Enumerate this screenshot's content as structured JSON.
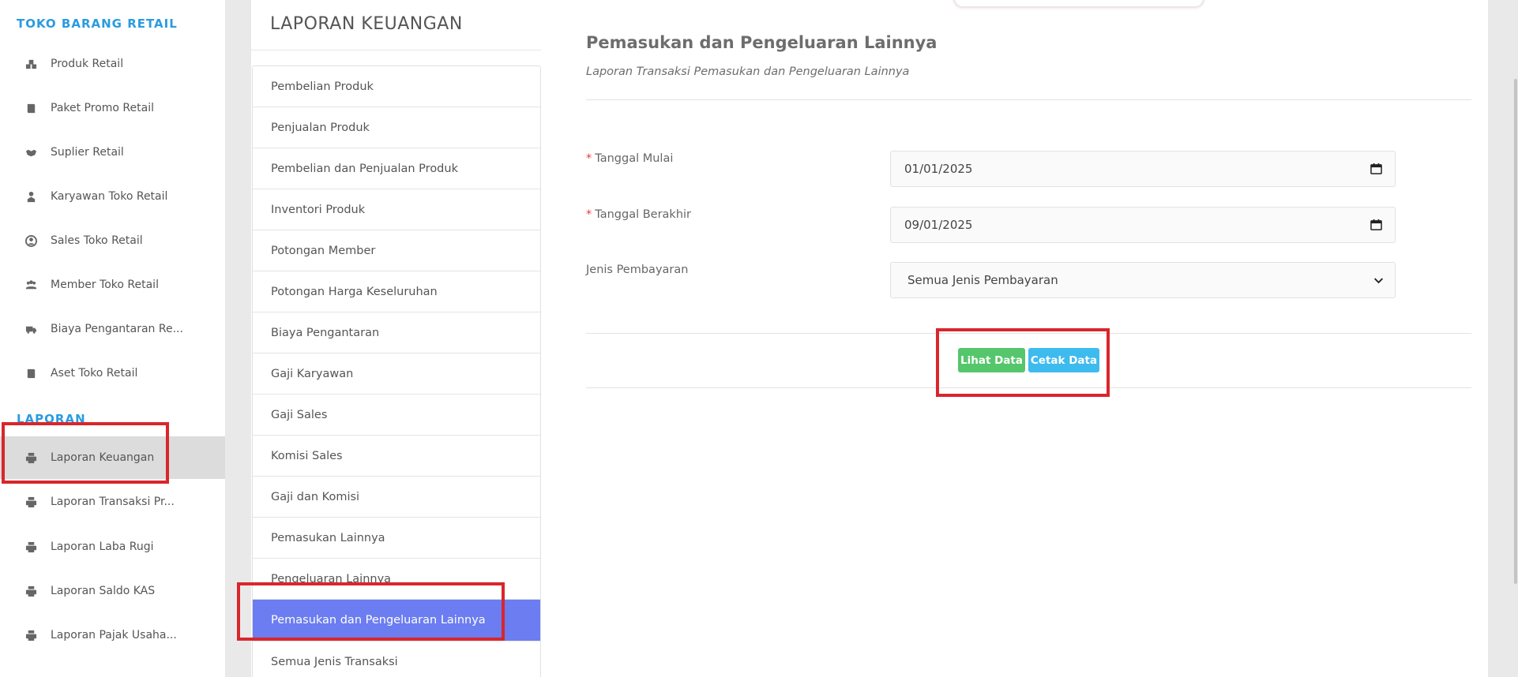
{
  "sidebar": {
    "section_retail": "TOKO BARANG RETAIL",
    "retail_items": [
      {
        "label": "Produk Retail",
        "icon": "cubes-icon"
      },
      {
        "label": "Paket Promo Retail",
        "icon": "book-icon"
      },
      {
        "label": "Suplier Retail",
        "icon": "handshake-icon"
      },
      {
        "label": "Karyawan Toko Retail",
        "icon": "user-tie-icon"
      },
      {
        "label": "Sales Toko Retail",
        "icon": "user-circle-icon"
      },
      {
        "label": "Member Toko Retail",
        "icon": "users-icon"
      },
      {
        "label": "Biaya Pengantaran Re...",
        "icon": "truck-icon"
      },
      {
        "label": "Aset Toko Retail",
        "icon": "book-icon"
      }
    ],
    "section_laporan": "LAPORAN",
    "laporan_items": [
      {
        "label": "Laporan Keuangan",
        "icon": "print-icon"
      },
      {
        "label": "Laporan Transaksi Pr...",
        "icon": "print-icon"
      },
      {
        "label": "Laporan Laba Rugi",
        "icon": "print-icon"
      },
      {
        "label": "Laporan Saldo KAS",
        "icon": "print-icon"
      },
      {
        "label": "Laporan Pajak Usaha...",
        "icon": "print-icon"
      }
    ],
    "active_item": "Laporan Keuangan"
  },
  "report_menu": {
    "title": "LAPORAN KEUANGAN",
    "items": [
      "Pembelian Produk",
      "Penjualan Produk",
      "Pembelian dan Penjualan Produk",
      "Inventori Produk",
      "Potongan Member",
      "Potongan Harga Keseluruhan",
      "Biaya Pengantaran",
      "Gaji Karyawan",
      "Gaji Sales",
      "Komisi Sales",
      "Gaji dan Komisi",
      "Pemasukan Lainnya",
      "Pengeluaran Lainnya",
      "Pemasukan dan Pengeluaran Lainnya",
      "Semua Jenis Transaksi"
    ],
    "selected": "Pemasukan dan Pengeluaran Lainnya"
  },
  "form": {
    "title": "Pemasukan dan Pengeluaran Lainnya",
    "subtitle": "Laporan Transaksi Pemasukan dan Pengeluaran Lainnya",
    "required_mark": "*",
    "start_date_label": "Tanggal Mulai",
    "start_date_value": "01/01/2025",
    "end_date_label": "Tanggal Berakhir",
    "end_date_value": "09/01/2025",
    "payment_label": "Jenis Pembayaran",
    "payment_value": "Semua Jenis Pembayaran",
    "view_button": "Lihat Data",
    "print_button": "Cetak Data"
  },
  "colors": {
    "accent_blue": "#2a9be0",
    "selected_menu": "#6b7df0",
    "btn_green": "#55c66b",
    "btn_blue": "#3ebbee",
    "highlight_red": "#d9262c"
  }
}
